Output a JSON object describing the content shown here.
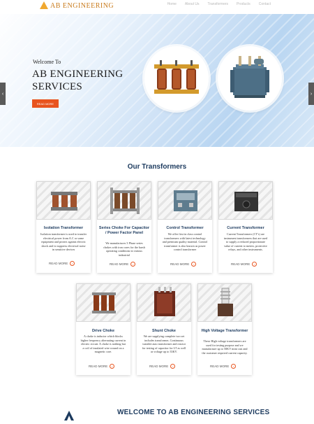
{
  "header": {
    "logo_text": "AB ENGINEERING",
    "nav": [
      "Home",
      "About Us",
      "Transformers",
      "Products",
      "Contact"
    ]
  },
  "hero": {
    "welcome": "Welcome To",
    "title": "AB ENGINEERING SERVICES",
    "button": "READ MORE",
    "prev_icon": "‹",
    "next_icon": "›"
  },
  "section": {
    "title": "Our Transformers"
  },
  "cards": [
    {
      "title": "Isolation Transformer",
      "desc": "Isolation transformer is used to transfer electrical power from A.C or some equipment and protect against electric shock and to suppress electrical noise in sensitive devices",
      "link": "READ MORE"
    },
    {
      "title": "Series Choke For Capacitor / Power Factor Panel",
      "desc": "We manufactures 3 Phase series chokes with iron cores for the harsh operating conditions in various industrial",
      "link": "READ MORE"
    },
    {
      "title": "Control Transformer",
      "desc": "We offer first in class control transformers with latest technology and premium quality material. Control transformer is also known as power control transformer",
      "link": "READ MORE"
    },
    {
      "title": "Current Transformer",
      "desc": "Current Transformers (CT's) are instrument transformers that are used to supply a reduced proportionate value of current to meters, protective relays, and other instruments.",
      "link": "READ MORE"
    },
    {
      "title": "Drive Choke",
      "desc": "A choke is inductor which blocks higher frequency alternating current in electric circuit. A choke is nothing but a coil of insulated wire wound on a magnetic core.",
      "link": "READ MORE"
    },
    {
      "title": "Shunt Choke",
      "desc": "We are supplying complete two set includes transformer, Continuous variable auto transformer and reactor for testing of capacitor for LT as well as voltage up to 33KV.",
      "link": "READ MORE"
    },
    {
      "title": "High Voltage Transformer",
      "desc": "These High voltage transformers are used for testing purpose and we manufacture up to 50KV mini cast and the customer required current capacity.",
      "link": "READ MORE"
    }
  ],
  "bottom": {
    "title": "WELCOME TO AB ENGINEERING SERVICES"
  },
  "colors": {
    "accent": "#e8541e",
    "heading": "#1c3a5e"
  }
}
